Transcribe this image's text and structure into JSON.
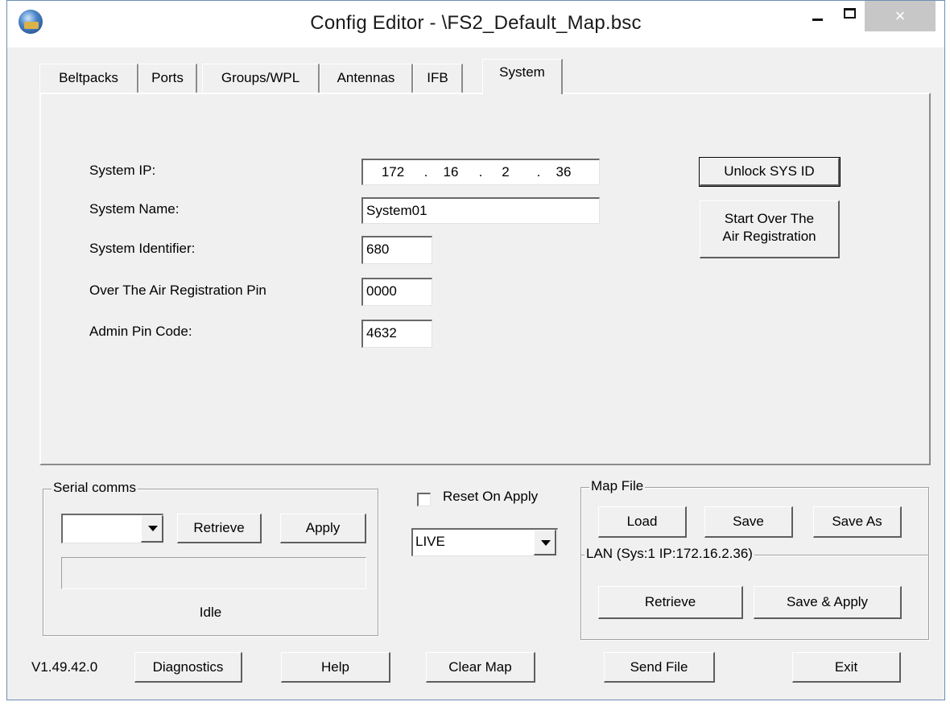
{
  "window": {
    "title": "Config Editor - \\FS2_Default_Map.bsc",
    "close_glyph": "×"
  },
  "tabs": [
    {
      "label": "Beltpacks"
    },
    {
      "label": "Ports"
    },
    {
      "label": "Groups/WPL"
    },
    {
      "label": "Antennas"
    },
    {
      "label": "IFB"
    },
    {
      "label": "System",
      "active": true
    }
  ],
  "system": {
    "ip_label": "System IP:",
    "ip": [
      "172",
      "16",
      "2",
      "36"
    ],
    "ip_dot": ".",
    "name_label": "System Name:",
    "name": "System01",
    "identifier_label": "System Identifier:",
    "identifier": "680",
    "ota_pin_label": "Over The Air Registration Pin",
    "ota_pin": "0000",
    "admin_pin_label": "Admin Pin Code:",
    "admin_pin": "4632",
    "unlock_button": "Unlock SYS ID",
    "start_over_line1": "Start Over The",
    "start_over_line2": "Air Registration"
  },
  "serial": {
    "group_title": "Serial comms",
    "port_value": "",
    "retrieve_button": "Retrieve",
    "apply_button": "Apply",
    "status": "Idle"
  },
  "middle": {
    "reset_on_apply_label": "Reset On Apply",
    "reset_on_apply_checked": false,
    "mode_value": "LIVE"
  },
  "map_file": {
    "group_title": "Map File",
    "load_button": "Load",
    "save_button": "Save",
    "save_as_button": "Save As",
    "lan_label": "LAN  (Sys:1 IP:172.16.2.36)",
    "lan_retrieve_button": "Retrieve",
    "save_apply_button": "Save & Apply"
  },
  "footer": {
    "version": "V1.49.42.0",
    "diagnostics_button": "Diagnostics",
    "help_button": "Help",
    "clear_map_button": "Clear Map",
    "send_file_button": "Send File",
    "exit_button": "Exit"
  },
  "icons": {
    "app_icon": "bsc-globe-icon",
    "minimize": "minimize-icon",
    "maximize": "maximize-icon",
    "close": "close-icon",
    "dropdown": "chevron-down-icon"
  },
  "colors": {
    "window_bg": "#f0f0f0",
    "title_bg": "#ffffff",
    "close_button_bg": "#c7c7c7",
    "window_border": "#6d8fb3"
  }
}
